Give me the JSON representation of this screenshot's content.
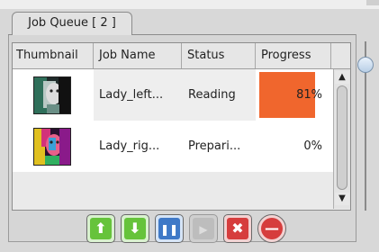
{
  "tab": {
    "label": "Job Queue [ 2 ]"
  },
  "table": {
    "columns": [
      "Thumbnail",
      "Job Name",
      "Status",
      "Progress"
    ],
    "rows": [
      {
        "thumbnail": "portrait-thumbnail",
        "name": "Lady_left...",
        "status": "Reading",
        "progress": 0.81,
        "progress_label": "81%",
        "progress_color": "#f0662d"
      },
      {
        "thumbnail": "portrait-thumbnail-colorized",
        "name": "Lady_rig...",
        "status": "Prepari...",
        "progress": 0,
        "progress_label": "0%"
      }
    ]
  },
  "scrollbar": {
    "up_icon": "▲",
    "down_icon": "▼"
  },
  "zoom_slider": {
    "value": 0.1
  },
  "toolbar": {
    "buttons": [
      {
        "icon": "move-up-icon",
        "glyph": "⬆",
        "color": "#66c33b"
      },
      {
        "icon": "move-down-icon",
        "glyph": "⬇",
        "color": "#66c33b"
      },
      {
        "icon": "pause-icon",
        "glyph": "❚❚",
        "color": "#3f79c7"
      },
      {
        "icon": "play-icon",
        "glyph": "▶",
        "color": "#bdbdbd",
        "disabled": true
      },
      {
        "icon": "cancel-icon",
        "glyph": "✖",
        "color": "#d63d3d"
      },
      {
        "icon": "remove-icon",
        "glyph": "—",
        "color": "#d63d3d"
      }
    ]
  }
}
